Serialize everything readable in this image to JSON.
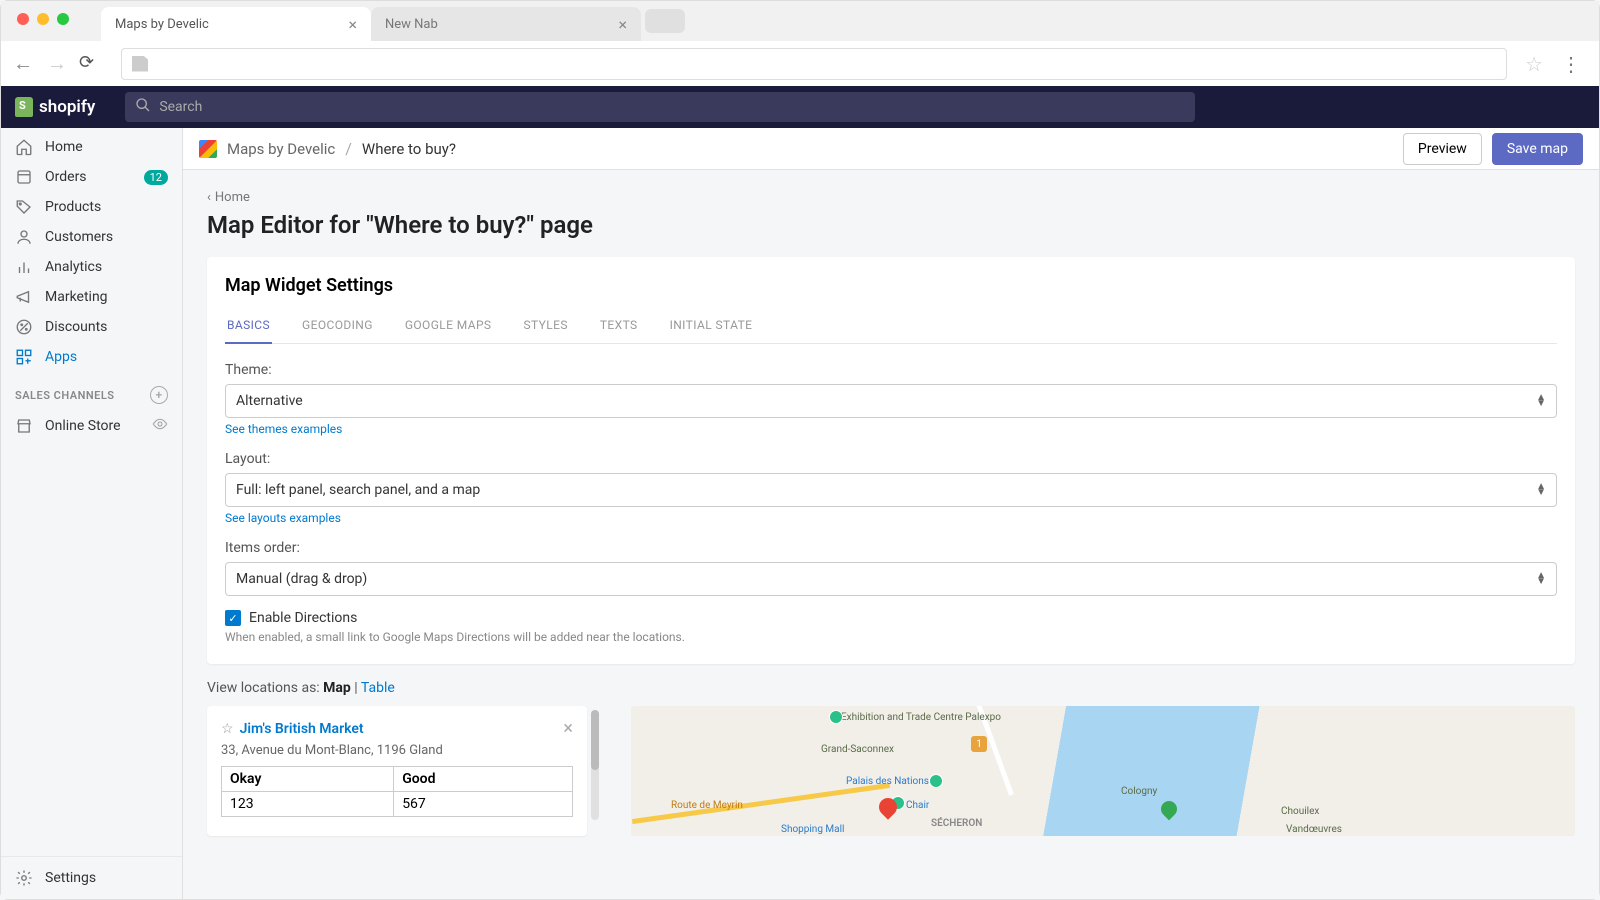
{
  "browser": {
    "tabs": [
      {
        "title": "Maps by Develic",
        "active": true
      },
      {
        "title": "New Nab",
        "active": false
      }
    ]
  },
  "shopify": {
    "brand": "shopify",
    "search_placeholder": "Search"
  },
  "sidebar": {
    "items": [
      {
        "label": "Home",
        "icon": "home"
      },
      {
        "label": "Orders",
        "icon": "orders",
        "badge": "12"
      },
      {
        "label": "Products",
        "icon": "products"
      },
      {
        "label": "Customers",
        "icon": "customers"
      },
      {
        "label": "Analytics",
        "icon": "analytics"
      },
      {
        "label": "Marketing",
        "icon": "marketing"
      },
      {
        "label": "Discounts",
        "icon": "discounts"
      },
      {
        "label": "Apps",
        "icon": "apps",
        "active": true
      }
    ],
    "section_label": "SALES CHANNELS",
    "channels": [
      {
        "label": "Online Store"
      }
    ],
    "settings_label": "Settings"
  },
  "breadcrumb": {
    "app": "Maps by Develic",
    "sep": "/",
    "current": "Where to buy?",
    "preview": "Preview",
    "save": "Save map"
  },
  "page": {
    "back": "Home",
    "title": "Map Editor for \"Where to buy?\" page"
  },
  "card": {
    "heading": "Map Widget Settings",
    "tabs": [
      "BASICS",
      "GEOCODING",
      "GOOGLE MAPS",
      "STYLES",
      "TEXTS",
      "INITIAL STATE"
    ],
    "theme_label": "Theme:",
    "theme_value": "Alternative",
    "theme_help": "See themes examples",
    "layout_label": "Layout:",
    "layout_value": "Full: left panel, search panel, and a map",
    "layout_help": "See layouts examples",
    "order_label": "Items order:",
    "order_value": "Manual (drag & drop)",
    "enable_label": "Enable Directions",
    "enable_help": "When enabled, a small link to Google Maps Directions will be added near the locations."
  },
  "view_as": {
    "prefix": "View locations as: ",
    "map": "Map",
    "sep": " | ",
    "table": "Table"
  },
  "location": {
    "name": "Jim's British Market",
    "address": "33, Avenue du Mont-Blanc, 1196 Gland",
    "headers": [
      "Okay",
      "Good"
    ],
    "values": [
      "123",
      "567"
    ]
  },
  "map_labels": {
    "l1": "Exhibition and Trade Centre Palexpo",
    "l2": "Grand-Saconnex",
    "l3": "Palais des Nations",
    "l4": "Route de Meyrin",
    "l5": "Shopping Mall",
    "l6": "Chair",
    "l7": "SÉCHERON",
    "l8": "Cologny",
    "l9": "Chouilex",
    "l10": "Vandœuvres"
  }
}
